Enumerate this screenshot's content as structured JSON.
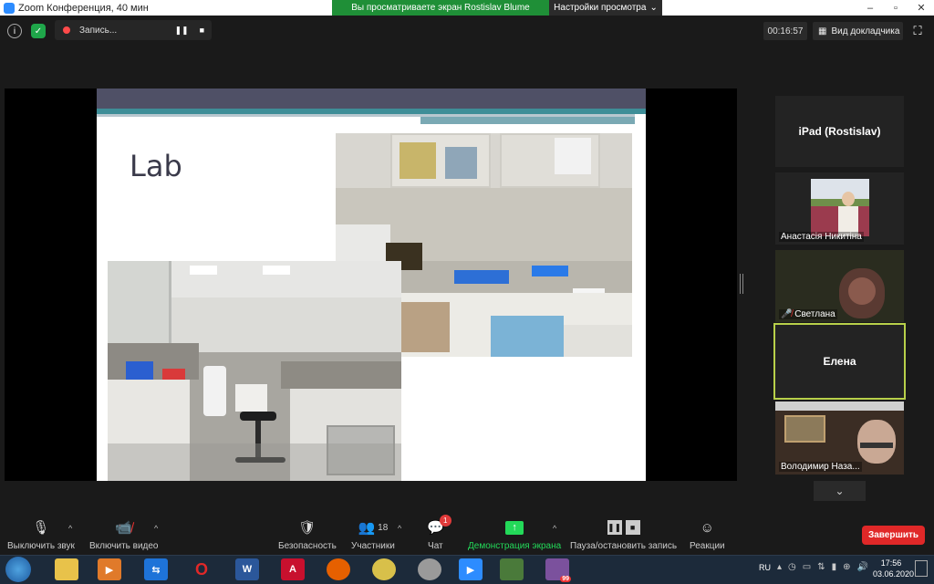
{
  "window": {
    "title": "Zoom Конференция, 40 мин",
    "banner": "Вы просматриваете экран Rostislav Blume",
    "view_options": "Настройки просмотра"
  },
  "topbar": {
    "recording_label": "Запись...",
    "timer": "00:16:57",
    "view_mode": "Вид докладчика"
  },
  "slide": {
    "title": "Lab"
  },
  "participants": [
    {
      "name": "iPad (Rostislav)"
    },
    {
      "name": "Анастасія Никитіна"
    },
    {
      "name": "Светлана"
    },
    {
      "name": "Елена"
    },
    {
      "name": "Володимир  Наза..."
    }
  ],
  "toolbar": {
    "mute": "Выключить звук",
    "video": "Включить видео",
    "security": "Безопасность",
    "participants": "Участники",
    "participants_count": "18",
    "chat": "Чат",
    "chat_badge": "1",
    "share": "Демонстрация экрана",
    "record": "Пауза/остановить запись",
    "reactions": "Реакции",
    "end": "Завершить"
  },
  "taskbar": {
    "lang": "RU",
    "time": "17:56",
    "date": "03.06.2020",
    "viber_badge": "99"
  },
  "colors": {
    "banner_green": "#1f8f37",
    "end_red": "#e02828",
    "active_speaker_border": "#b8d04a",
    "share_active": "#23d959"
  }
}
